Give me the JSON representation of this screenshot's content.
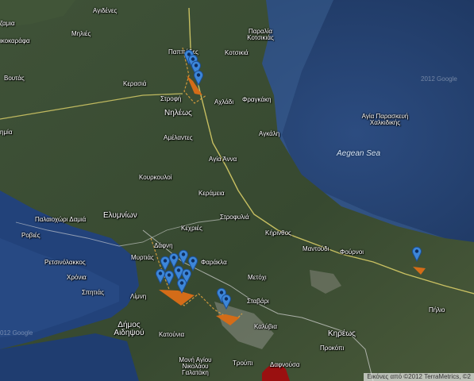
{
  "map": {
    "colors": {
      "sea_deep": "#1f3a66",
      "sea_shallow": "#3a5a86",
      "land": "#3c4d34",
      "road_main": "#e0d36a",
      "road_minor": "#d8d8d8",
      "border": "#e6a640",
      "marker": "#3d86d8"
    },
    "labels": {
      "agidenes": "Αγιδένες",
      "tzamia": "ζαμια",
      "mileies": "Μηλιές",
      "likokarpha": "ικοκαράφα",
      "voutas": "Βουτάς",
      "pappades": "Παππάδες",
      "paralia_kotsikias": "Παραλία Κοτσικιάς",
      "kotsikia": "Κοτσικιά",
      "kerasia": "Κερασιά",
      "strofi": "Στροφή",
      "achladi": "Αχλάδι",
      "fragkaki": "Φραγκάκη",
      "nileos": "Νηλέως",
      "simia": "ημία",
      "amelantes": "Αμέλαντες",
      "agkali": "Αγκάλη",
      "agia_anna": "Αγία Άννα",
      "agia_paraskevi": "Αγία Παρασκευή Χαλκιδικής",
      "aegean_sea": "Aegean Sea",
      "kourkouloi": "Κουρκουλοί",
      "keramia": "Κεράμεια",
      "elymnion": "Ελυμνίων",
      "palaiochori_damia": "Παλαιοχώρι Δαμιά",
      "strofylia": "Στροφυλιά",
      "rovies": "Ροβιές",
      "kechries": "Κεχριές",
      "krinthos": "Κήρινθος",
      "dafni": "Δάφνη",
      "retsinolakkos": "Ρετσινόλακκος",
      "myrtias": "Μυρτιάς",
      "mantoudi": "Μαντούδι",
      "fourni": "Φούρνοι",
      "farakla": "Φαράκλα",
      "chronia": "Χρόνια",
      "spitias": "Σπητιάς",
      "limni": "Λίμνη",
      "metochi": "Μετόχι",
      "stavari": "Σταβάρι",
      "pilio": "Πήλιο",
      "dimos_aidipsou": "Δήμος Αιδηψού",
      "kalyvia": "Καλύβια",
      "kreos": "Κηρέως",
      "katounia": "Κατούνια",
      "prokopi": "Προκόπι",
      "moni_agiou": "Μονή Αγίου Νικολάου Γαλατάκη",
      "troupi": "Τρούπι",
      "dafnousa": "Δαφνούσα",
      "google_wm_1": "2012 Google",
      "google_wm_2": "012 Google"
    },
    "attribution": "Εικόνες από ©2012 TerraMetrics, ©2"
  }
}
